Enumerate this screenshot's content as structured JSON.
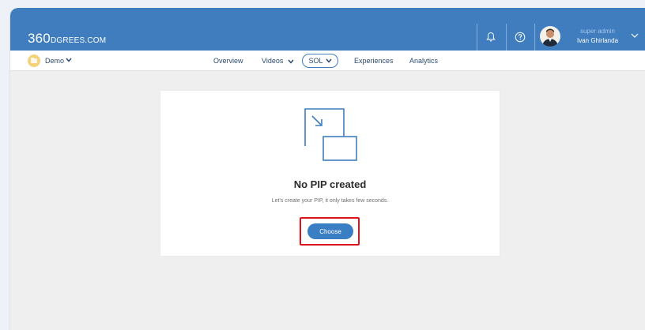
{
  "brand": {
    "logo_big": "360",
    "logo_small": "DGREES.COM"
  },
  "user": {
    "role": "super admin",
    "name": "Ivan Ghirlanda"
  },
  "project": {
    "name": "Demo"
  },
  "nav": {
    "tabs": [
      {
        "label": "Overview"
      },
      {
        "label": "Videos"
      },
      {
        "label": "SOL"
      },
      {
        "label": "Experiences"
      },
      {
        "label": "Analytics"
      }
    ]
  },
  "empty_state": {
    "title": "No PIP created",
    "subtitle": "Let's create your PIP, it only takes few seconds.",
    "button_label": "Choose"
  },
  "colors": {
    "header": "#3f7dbe",
    "button": "#3a7fc3",
    "highlight": "#e0131c"
  }
}
